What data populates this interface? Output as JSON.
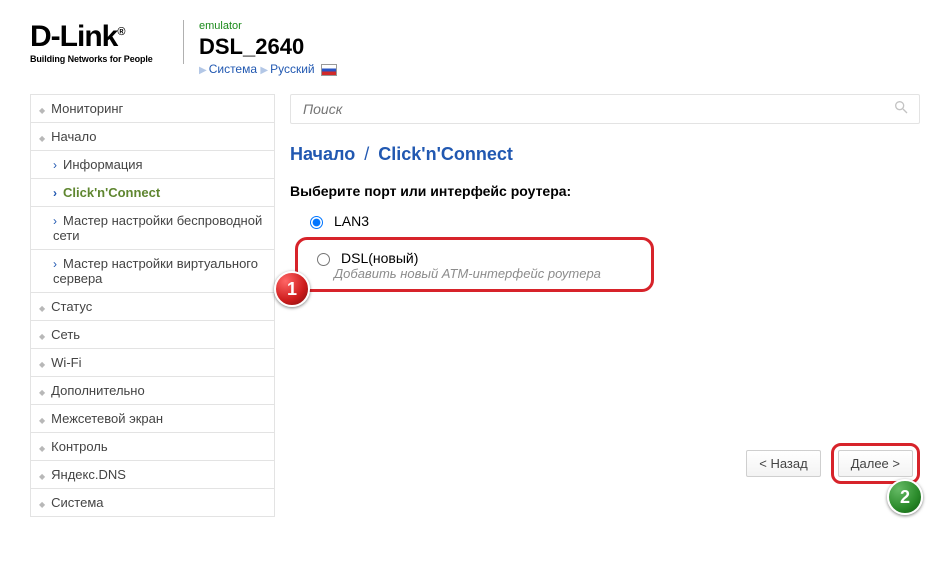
{
  "header": {
    "logo_tagline": "Building Networks for People",
    "emulator": "emulator",
    "device": "DSL_2640",
    "system_link": "Система",
    "language_link": "Русский"
  },
  "sidebar": {
    "items": [
      {
        "label": "Мониторинг",
        "level": 0
      },
      {
        "label": "Начало",
        "level": 0,
        "expanded": true
      },
      {
        "label": "Информация",
        "level": 1
      },
      {
        "label": "Click'n'Connect",
        "level": 1,
        "active": true
      },
      {
        "label": "Мастер настройки беспроводной сети",
        "level": 1
      },
      {
        "label": "Мастер настройки виртуального сервера",
        "level": 1
      },
      {
        "label": "Статус",
        "level": 0
      },
      {
        "label": "Сеть",
        "level": 0
      },
      {
        "label": "Wi-Fi",
        "level": 0
      },
      {
        "label": "Дополнительно",
        "level": 0
      },
      {
        "label": "Межсетевой экран",
        "level": 0
      },
      {
        "label": "Контроль",
        "level": 0
      },
      {
        "label": "Яндекс.DNS",
        "level": 0
      },
      {
        "label": "Система",
        "level": 0
      }
    ]
  },
  "content": {
    "search_placeholder": "Поиск",
    "breadcrumb_root": "Начало",
    "breadcrumb_page": "Click'n'Connect",
    "prompt": "Выберите порт или интерфейс роутера:",
    "opt1": "LAN3",
    "opt2": "DSL(новый)",
    "opt2_hint": "Добавить новый ATM-интерфейс роутера",
    "btn_back": "< Назад",
    "btn_next": "Далее >"
  },
  "callouts": {
    "c1": "1",
    "c2": "2"
  }
}
